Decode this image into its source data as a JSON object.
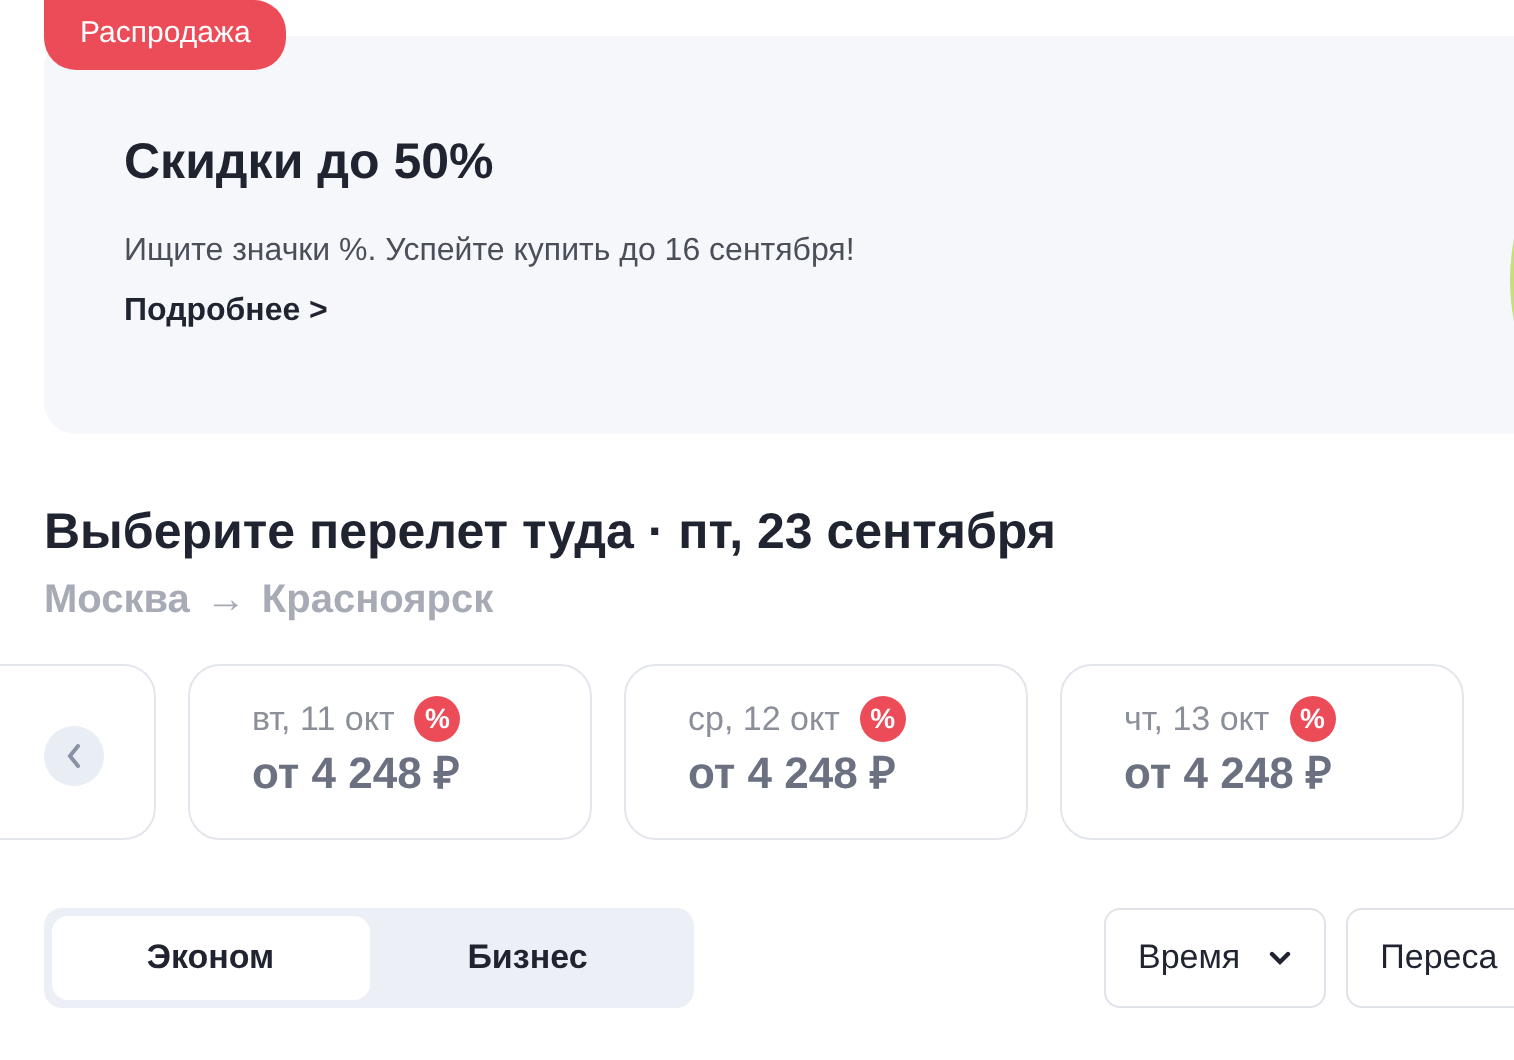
{
  "promo": {
    "badge": "Распродажа",
    "title": "Скидки до 50%",
    "text": "Ищите значки %. Успейте купить до 16 сентября!",
    "link": "Подробнее >"
  },
  "heading": "Выберите перелет туда · пт, 23 сентября",
  "route": {
    "from": "Москва",
    "arrow": "→",
    "to": "Красноярск"
  },
  "dates": [
    {
      "date": "вт, 11 окт",
      "price": "от 4 248 ₽",
      "discount": true,
      "discount_mark": "%"
    },
    {
      "date": "ср, 12 окт",
      "price": "от 4 248 ₽",
      "discount": true,
      "discount_mark": "%"
    },
    {
      "date": "чт, 13 окт",
      "price": "от 4 248 ₽",
      "discount": true,
      "discount_mark": "%"
    }
  ],
  "classes": [
    {
      "label": "Эконом",
      "selected": true
    },
    {
      "label": "Бизнес",
      "selected": false
    }
  ],
  "filters": [
    {
      "label": "Время",
      "kind": "dropdown"
    },
    {
      "label": "Переса",
      "kind": "button"
    }
  ]
}
